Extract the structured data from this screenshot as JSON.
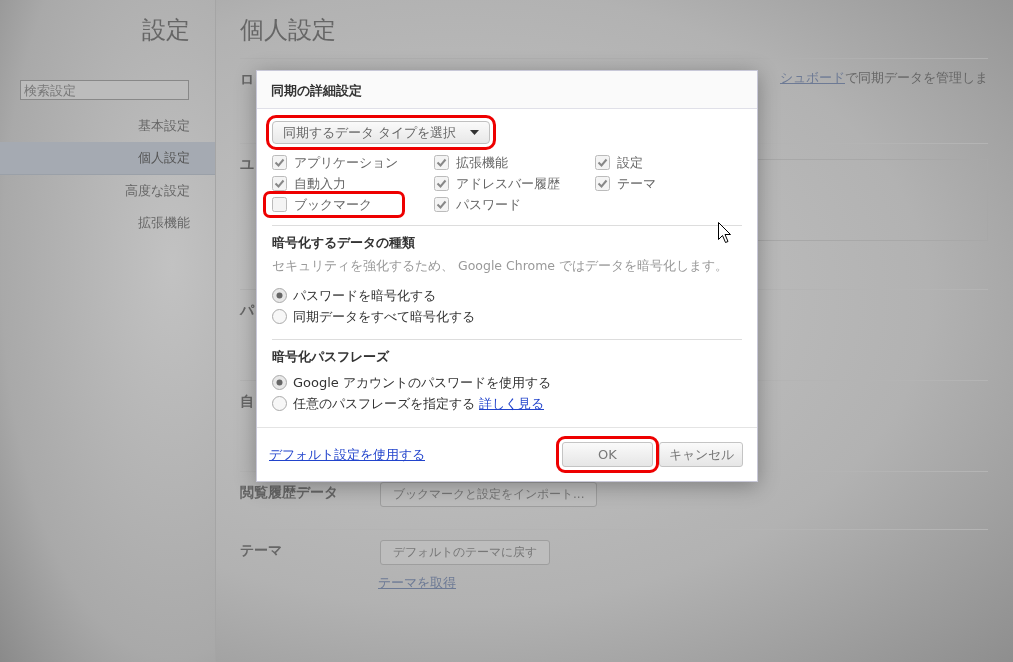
{
  "sidebar": {
    "title": "設定",
    "search": {
      "placeholder": "検索設定"
    },
    "items": [
      {
        "label": "基本設定",
        "selected": false
      },
      {
        "label": "個人設定",
        "selected": true
      },
      {
        "label": "高度な設定",
        "selected": false
      },
      {
        "label": "拡張機能",
        "selected": false
      }
    ]
  },
  "page": {
    "title": "個人設定",
    "sections": [
      {
        "kind": "sync",
        "label": "ロ",
        "link": "シュボード",
        "text": "で同期データを管理しま"
      },
      {
        "kind": "panel",
        "label": "ユ"
      },
      {
        "kind": "plain",
        "label": "パ"
      },
      {
        "kind": "plain",
        "label": "自"
      },
      {
        "kind": "buttons",
        "label": "閲覧履歴データ",
        "buttons": [
          "ブックマークと設定をインポート..."
        ]
      },
      {
        "kind": "buttons",
        "label": "テーマ",
        "buttons": [
          "デフォルトのテーマに戻す"
        ],
        "link": "テーマを取得"
      }
    ]
  },
  "dialog": {
    "title": "同期の詳細設定",
    "data_types": {
      "label": "同期するデータ タイプを選択",
      "highlighted": true
    },
    "checkboxes": [
      {
        "label": "アプリケーション",
        "checked": true,
        "highlighted": false
      },
      {
        "label": "拡張機能",
        "checked": true,
        "highlighted": false
      },
      {
        "label": "設定",
        "checked": true,
        "highlighted": false
      },
      {
        "label": "自動入力",
        "checked": true,
        "highlighted": false
      },
      {
        "label": "アドレスバー履歴",
        "checked": true,
        "highlighted": false
      },
      {
        "label": "テーマ",
        "checked": true,
        "highlighted": false
      },
      {
        "label": "ブックマーク",
        "checked": false,
        "highlighted": true
      },
      {
        "label": "パスワード",
        "checked": true,
        "highlighted": false
      }
    ],
    "encryption": {
      "heading": "暗号化するデータの種類",
      "note": "セキュリティを強化するため、 Google Chrome ではデータを暗号化します。",
      "options": [
        {
          "label": "パスワードを暗号化する",
          "selected": true
        },
        {
          "label": "同期データをすべて暗号化する",
          "selected": false
        }
      ]
    },
    "passphrase": {
      "heading": "暗号化パスフレーズ",
      "options": [
        {
          "label": "Google アカウントのパスワードを使用する",
          "selected": true
        },
        {
          "label": "任意のパスフレーズを指定する",
          "selected": false,
          "link": "詳しく見る"
        }
      ]
    },
    "footer": {
      "link": "デフォルト設定を使用する",
      "buttons": [
        {
          "label": "OK",
          "highlighted": true
        },
        {
          "label": "キャンセル",
          "highlighted": false
        }
      ]
    }
  }
}
